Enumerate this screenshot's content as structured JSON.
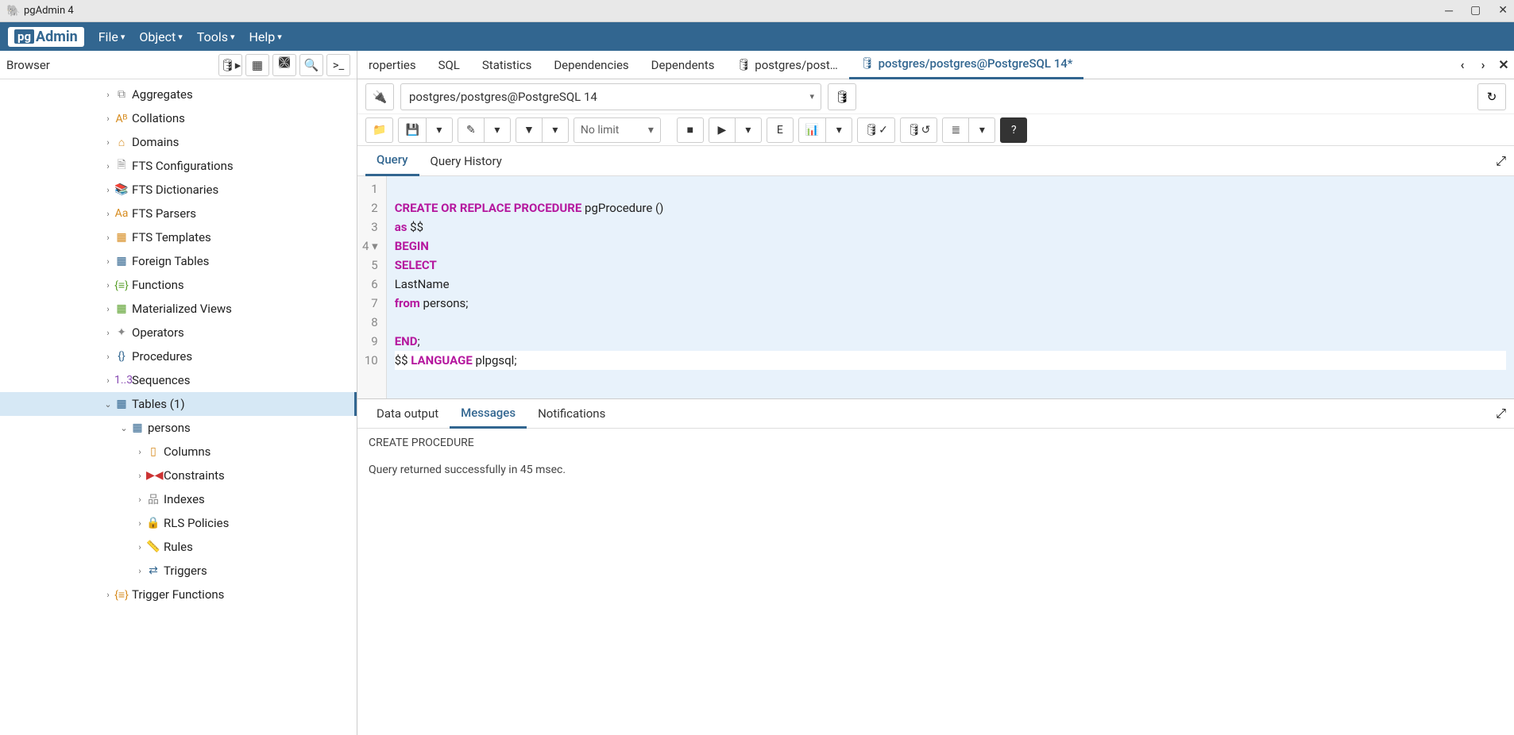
{
  "titlebar": {
    "title": "pgAdmin 4"
  },
  "menu": {
    "file": "File",
    "object": "Object",
    "tools": "Tools",
    "help": "Help"
  },
  "browser": {
    "title": "Browser",
    "items": [
      {
        "label": "Aggregates",
        "indent": 128,
        "chev": "›",
        "icon": "⧉",
        "color": "c-gray",
        "sel": false
      },
      {
        "label": "Collations",
        "indent": 128,
        "chev": "›",
        "icon": "Aᴮ",
        "color": "c-orange",
        "sel": false
      },
      {
        "label": "Domains",
        "indent": 128,
        "chev": "›",
        "icon": "⌂",
        "color": "c-orange",
        "sel": false
      },
      {
        "label": "FTS Configurations",
        "indent": 128,
        "chev": "›",
        "icon": "🗎",
        "color": "c-gray",
        "sel": false
      },
      {
        "label": "FTS Dictionaries",
        "indent": 128,
        "chev": "›",
        "icon": "📚",
        "color": "c-blue",
        "sel": false
      },
      {
        "label": "FTS Parsers",
        "indent": 128,
        "chev": "›",
        "icon": "Aa",
        "color": "c-orange",
        "sel": false
      },
      {
        "label": "FTS Templates",
        "indent": 128,
        "chev": "›",
        "icon": "▦",
        "color": "c-orange",
        "sel": false
      },
      {
        "label": "Foreign Tables",
        "indent": 128,
        "chev": "›",
        "icon": "▦",
        "color": "c-blue",
        "sel": false
      },
      {
        "label": "Functions",
        "indent": 128,
        "chev": "›",
        "icon": "{≡}",
        "color": "c-green",
        "sel": false
      },
      {
        "label": "Materialized Views",
        "indent": 128,
        "chev": "›",
        "icon": "▦",
        "color": "c-green",
        "sel": false
      },
      {
        "label": "Operators",
        "indent": 128,
        "chev": "›",
        "icon": "✦",
        "color": "c-gray",
        "sel": false
      },
      {
        "label": "Procedures",
        "indent": 128,
        "chev": "›",
        "icon": "{}",
        "color": "c-blue",
        "sel": false
      },
      {
        "label": "Sequences",
        "indent": 128,
        "chev": "›",
        "icon": "1..3",
        "color": "c-purple",
        "sel": false
      },
      {
        "label": "Tables (1)",
        "indent": 128,
        "chev": "⌄",
        "icon": "▦",
        "color": "c-blue",
        "sel": true
      },
      {
        "label": "persons",
        "indent": 148,
        "chev": "⌄",
        "icon": "▦",
        "color": "c-blue",
        "sel": false
      },
      {
        "label": "Columns",
        "indent": 168,
        "chev": "›",
        "icon": "▯",
        "color": "c-orange",
        "sel": false
      },
      {
        "label": "Constraints",
        "indent": 168,
        "chev": "›",
        "icon": "▶◀",
        "color": "c-red",
        "sel": false
      },
      {
        "label": "Indexes",
        "indent": 168,
        "chev": "›",
        "icon": "品",
        "color": "c-gray",
        "sel": false
      },
      {
        "label": "RLS Policies",
        "indent": 168,
        "chev": "›",
        "icon": "🔒",
        "color": "c-orange",
        "sel": false
      },
      {
        "label": "Rules",
        "indent": 168,
        "chev": "›",
        "icon": "📏",
        "color": "c-orange",
        "sel": false
      },
      {
        "label": "Triggers",
        "indent": 168,
        "chev": "›",
        "icon": "⇄",
        "color": "c-blue",
        "sel": false
      },
      {
        "label": "Trigger Functions",
        "indent": 128,
        "chev": "›",
        "icon": "{≡}",
        "color": "c-orange",
        "sel": false
      }
    ]
  },
  "tabs": {
    "list": [
      {
        "label": "roperties",
        "active": false,
        "icon": ""
      },
      {
        "label": "SQL",
        "active": false,
        "icon": ""
      },
      {
        "label": "Statistics",
        "active": false,
        "icon": ""
      },
      {
        "label": "Dependencies",
        "active": false,
        "icon": ""
      },
      {
        "label": "Dependents",
        "active": false,
        "icon": ""
      },
      {
        "label": "postgres/post…",
        "active": false,
        "icon": "🛢"
      },
      {
        "label": "postgres/postgres@PostgreSQL 14*",
        "active": true,
        "icon": "🛢"
      }
    ]
  },
  "connection": {
    "value": "postgres/postgres@PostgreSQL 14"
  },
  "toolbar": {
    "nolimit": "No limit"
  },
  "querytabs": {
    "query": "Query",
    "history": "Query History"
  },
  "code": {
    "lines": [
      {
        "n": "1",
        "tokens": [
          {
            "t": "",
            "c": ""
          }
        ]
      },
      {
        "n": "2",
        "tokens": [
          {
            "t": "CREATE OR REPLACE PROCEDURE",
            "c": "kw"
          },
          {
            "t": " pgProcedure ()",
            "c": "ident"
          }
        ]
      },
      {
        "n": "3",
        "tokens": [
          {
            "t": "as",
            "c": "kw"
          },
          {
            "t": " $$",
            "c": "ident"
          }
        ]
      },
      {
        "n": "4 ▾",
        "tokens": [
          {
            "t": "BEGIN",
            "c": "kw"
          }
        ]
      },
      {
        "n": "5",
        "tokens": [
          {
            "t": "SELECT",
            "c": "kw"
          }
        ]
      },
      {
        "n": "6",
        "tokens": [
          {
            "t": "LastName",
            "c": "ident"
          }
        ]
      },
      {
        "n": "7",
        "tokens": [
          {
            "t": "from",
            "c": "kw"
          },
          {
            "t": " persons;",
            "c": "ident"
          }
        ]
      },
      {
        "n": "8",
        "tokens": [
          {
            "t": "",
            "c": ""
          }
        ]
      },
      {
        "n": "9",
        "tokens": [
          {
            "t": "END",
            "c": "kw"
          },
          {
            "t": ";",
            "c": "ident"
          }
        ]
      },
      {
        "n": "10",
        "tokens": [
          {
            "t": "$$ ",
            "c": "ident"
          },
          {
            "t": "LANGUAGE",
            "c": "kw"
          },
          {
            "t": " plpgsql;",
            "c": "ident"
          }
        ],
        "nohl": true
      }
    ]
  },
  "outputtabs": {
    "data": "Data output",
    "messages": "Messages",
    "notifications": "Notifications"
  },
  "messages": {
    "line1": "CREATE PROCEDURE",
    "line2": "Query returned successfully in 45 msec."
  }
}
